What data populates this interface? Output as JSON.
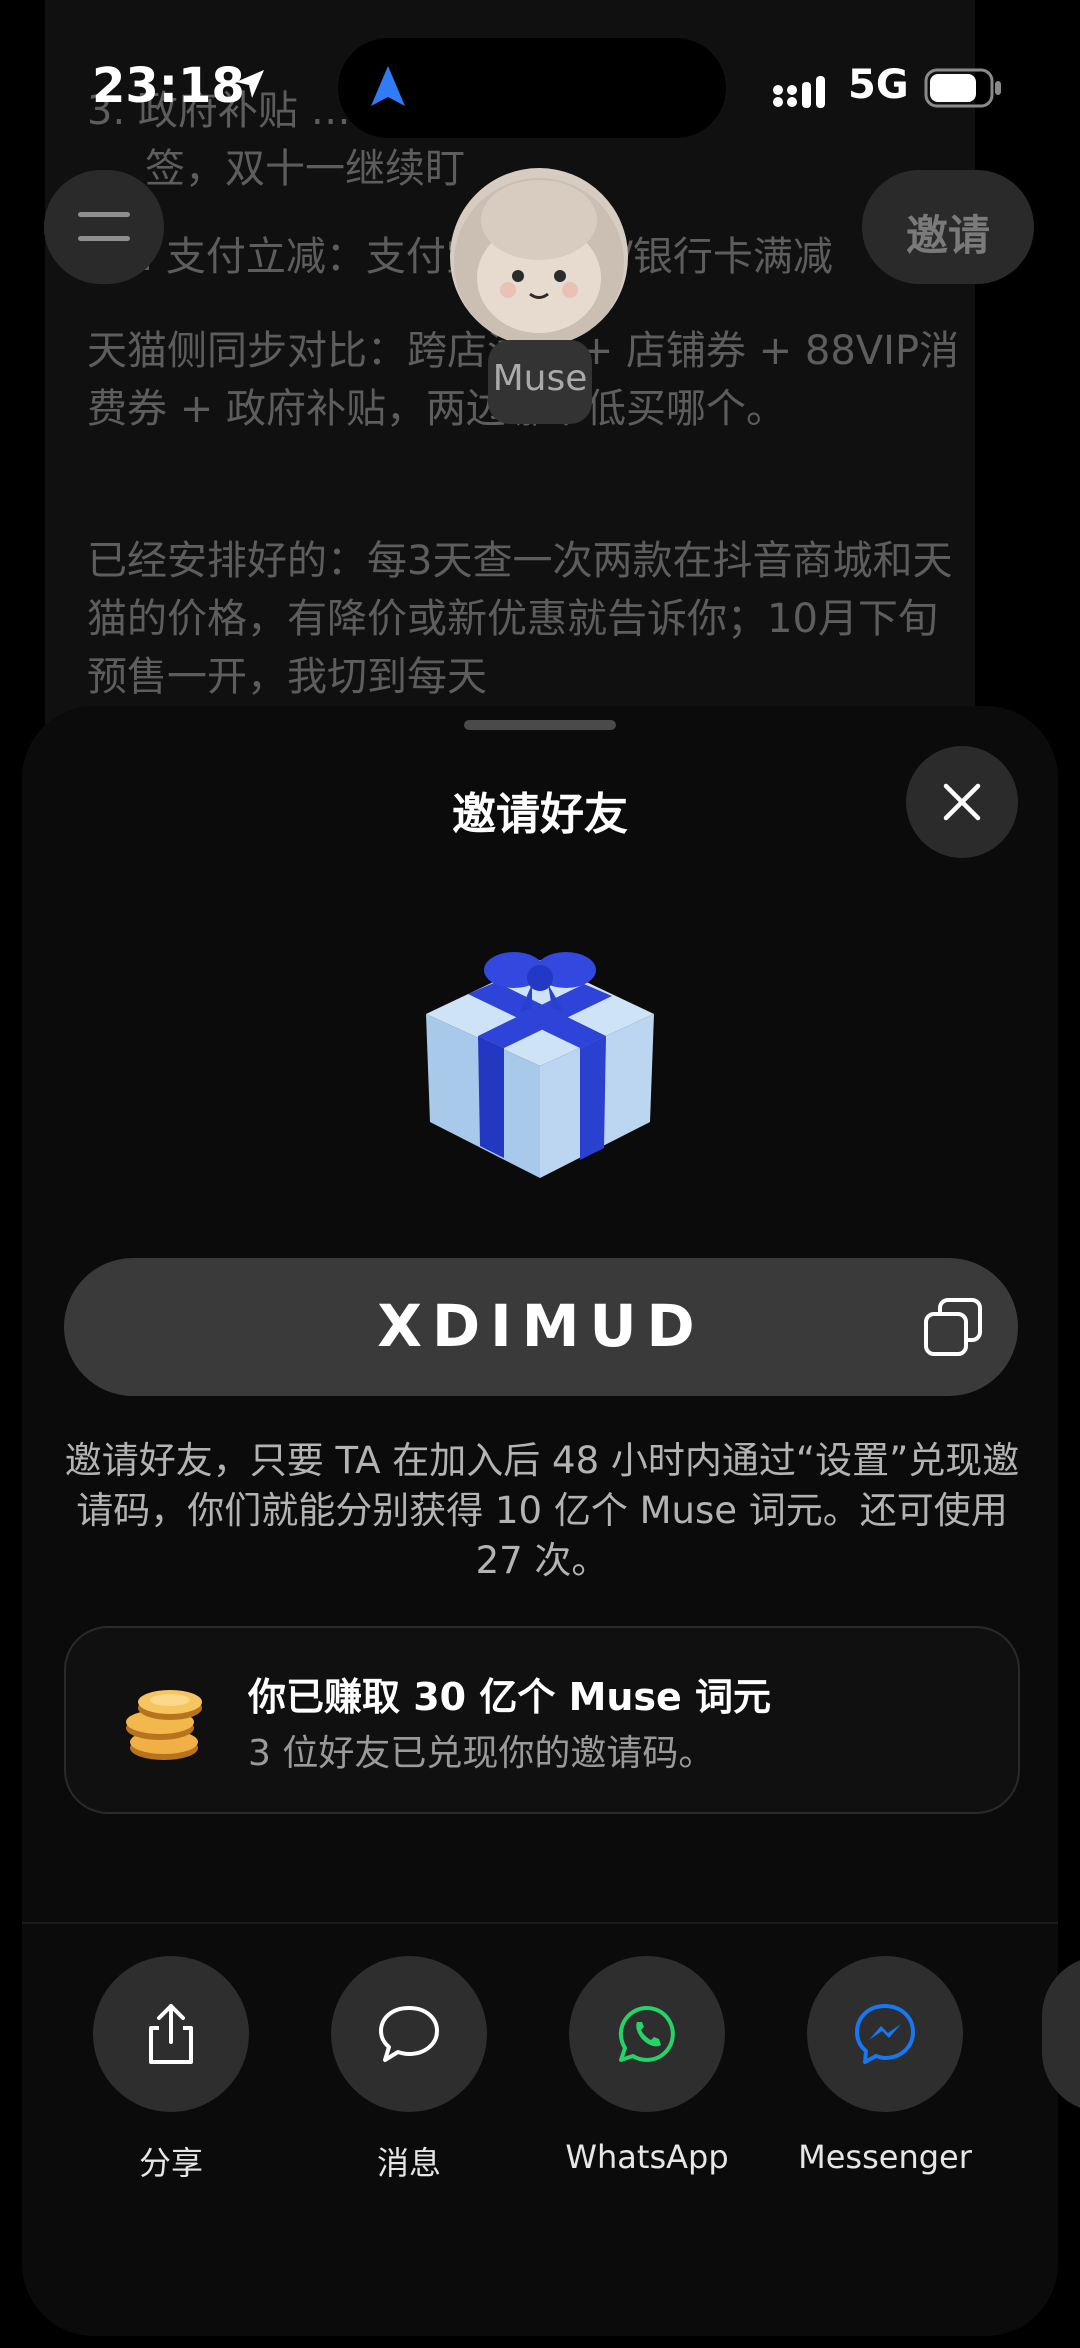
{
  "status_bar": {
    "time": "23:18",
    "network": "5G"
  },
  "background_chat": {
    "line1": "3. 政府补贴 … 有补贴标",
    "line2": "签，双十一继续盯",
    "line3": "4. 支付立减：支付宝/云闪付/银行卡满减",
    "para1": "天猫侧同步对比：跨店满减 + 店铺券 + 88VIP消费券 + 政府补贴，两边哪个低买哪个。",
    "para2": "已经安排好的：每3天查一次两款在抖音商城和天猫的价格，有降价或新优惠就告诉你；10月下旬预售一开，我切到每天"
  },
  "header": {
    "assistant_name": "Muse",
    "invite_label": "邀请"
  },
  "sheet": {
    "title": "邀请好友",
    "invite_code": "XDIMUD",
    "description": "邀请好友，只要 TA 在加入后 48 小时内通过“设置”兑现邀请码，你们就能分别获得 10 亿个 Muse 词元。还可使用 27 次。",
    "earned": {
      "title": "你已赚取 30 亿个 Muse 词元",
      "subtitle": "3 位好友已兑现你的邀请码。"
    },
    "share_options": [
      {
        "label": "分享",
        "icon": "share-icon"
      },
      {
        "label": "消息",
        "icon": "message-icon"
      },
      {
        "label": "WhatsApp",
        "icon": "whatsapp-icon"
      },
      {
        "label": "Messenger",
        "icon": "messenger-icon"
      }
    ]
  },
  "colors": {
    "whatsapp": "#25D366",
    "messenger": "#1877F2",
    "island_arrow": "#2F7CF6"
  }
}
